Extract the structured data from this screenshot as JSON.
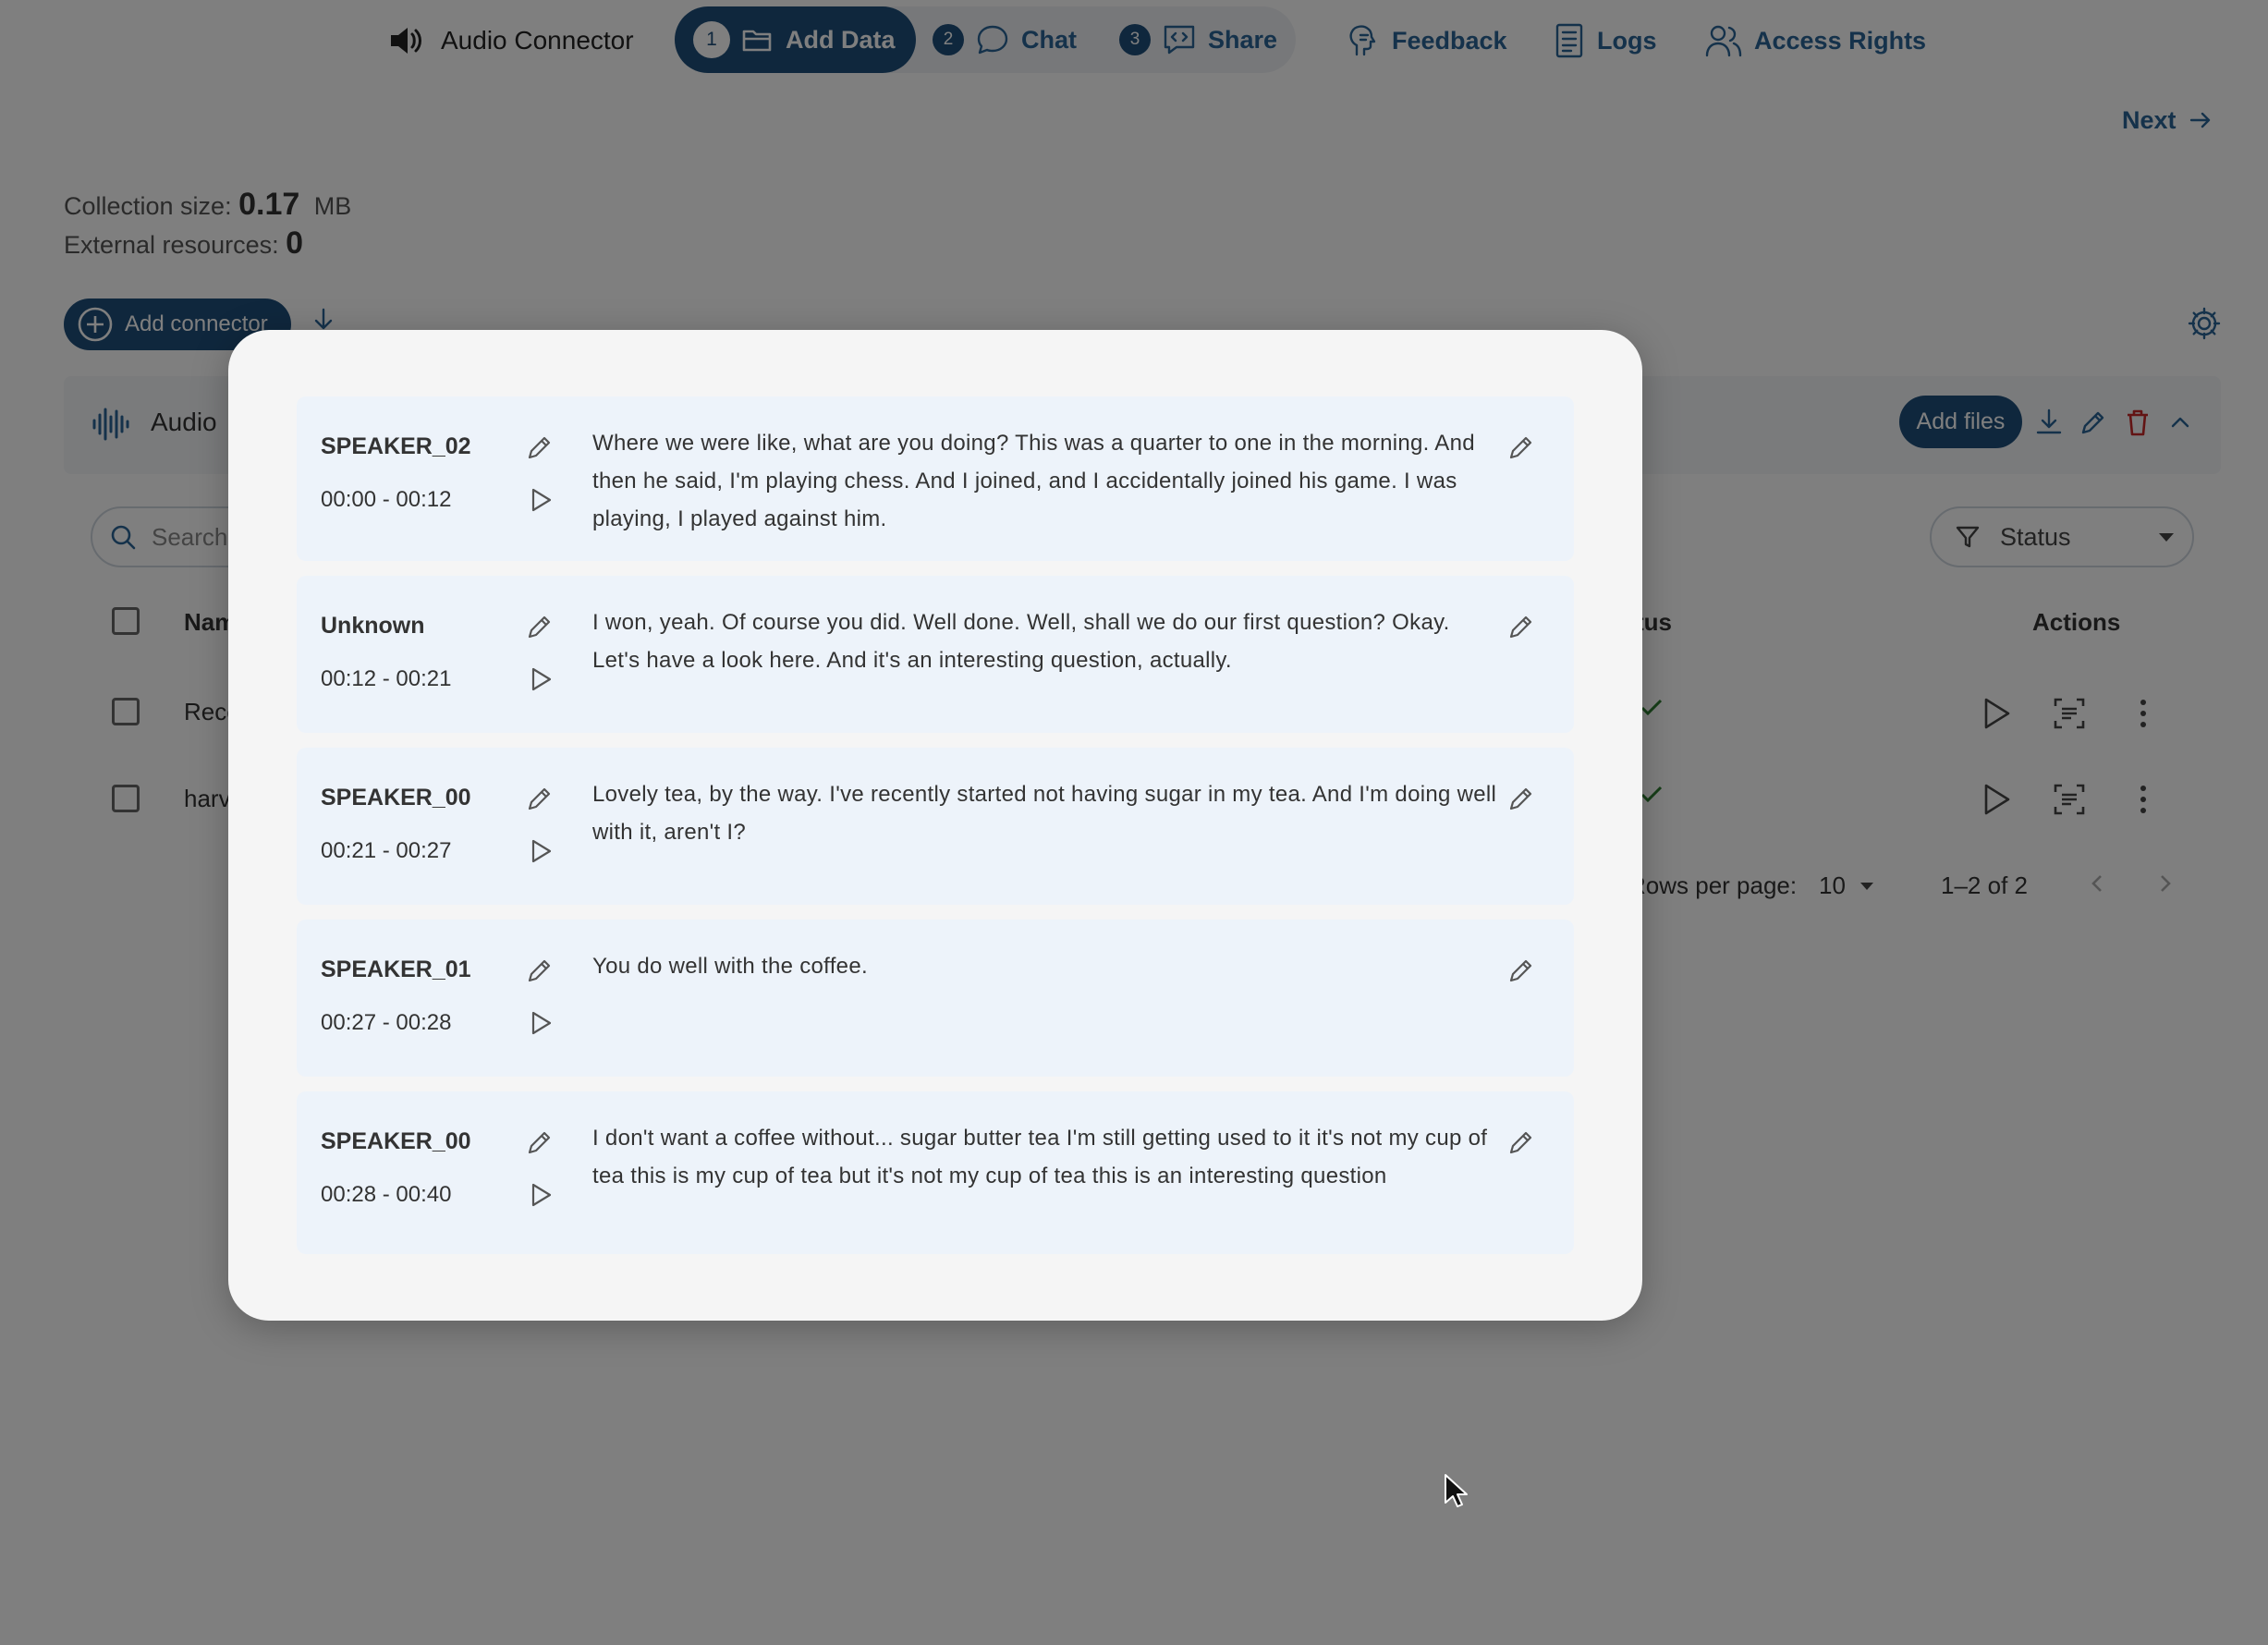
{
  "nav": {
    "app_name": "Audio Connector",
    "steps": [
      {
        "num": "1",
        "label": "Add Data"
      },
      {
        "num": "2",
        "label": "Chat"
      },
      {
        "num": "3",
        "label": "Share"
      }
    ],
    "links": {
      "feedback": "Feedback",
      "logs": "Logs",
      "access_rights": "Access Rights"
    },
    "next": "Next"
  },
  "stats": {
    "collection_label": "Collection size:",
    "collection_value": "0.17",
    "collection_unit": "MB",
    "external_label": "External resources:",
    "external_value": "0"
  },
  "toolbar": {
    "add_connector": "Add connector"
  },
  "connector": {
    "name": "Audio",
    "add_files": "Add files"
  },
  "table": {
    "search_placeholder": "Search",
    "status_filter": "Status",
    "headers": {
      "name": "Nam",
      "status": "tus",
      "actions": "Actions"
    },
    "rows": [
      {
        "name": "Reco"
      },
      {
        "name": "harv"
      }
    ],
    "rows_per_page_label": "Rows per page:",
    "rows_per_page": "10",
    "range": "1–2 of 2"
  },
  "transcript": {
    "segments": [
      {
        "speaker": "SPEAKER_02",
        "time": "00:00 - 00:12",
        "text": "Where we were like, what are you doing? This was a quarter to one in the morning. And then he said, I'm playing chess. And I joined, and I accidentally joined his game. I was playing, I played against him."
      },
      {
        "speaker": "Unknown",
        "time": "00:12 - 00:21",
        "text": "I won, yeah. Of course you did. Well done. Well, shall we do our first question? Okay. Let's have a look here. And it's an interesting question, actually."
      },
      {
        "speaker": "SPEAKER_00",
        "time": "00:21 - 00:27",
        "text": "Lovely tea, by the way. I've recently started not having sugar in my tea. And I'm doing well with it, aren't I?"
      },
      {
        "speaker": "SPEAKER_01",
        "time": "00:27 - 00:28",
        "text": "You do well with the coffee."
      },
      {
        "speaker": "SPEAKER_00",
        "time": "00:28 - 00:40",
        "text": "I don't want a coffee without... sugar butter tea I'm still getting used to it it's not my cup of tea this is my cup of tea but it's not my cup of tea this is an interesting question"
      }
    ]
  },
  "colors": {
    "primary": "#1f4f7a",
    "accent": "#2a6496",
    "segment_bg": "#edf3fa",
    "delete": "#c62828",
    "ok": "#2e7d32"
  }
}
